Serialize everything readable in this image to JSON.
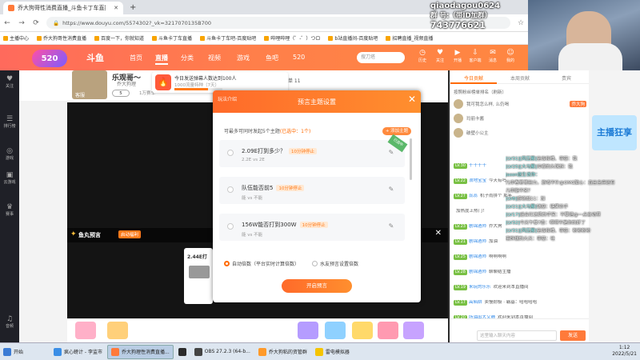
{
  "browser": {
    "tab_title": "乔大狗哥性消费直播_斗鱼卡丁车直播",
    "new_tab": "+",
    "url": "https://www.douyu.com/5574302?_vk=3217070135B700",
    "bookmarks": [
      "主播中心",
      "乔大狗哥性消费直播",
      "百度一下，你就知道",
      "斗鱼卡丁车直播",
      "斗鱼卡丁车吧-百度贴吧",
      "哔哩哔哩（゜-゜）つロ",
      "b站直播间-百度贴吧",
      "招聘直播_视频直播"
    ]
  },
  "header": {
    "badge": "520",
    "logo": "斗鱼",
    "nav": [
      "首页",
      "直播",
      "分类",
      "视频",
      "游戏",
      "鱼吧",
      "520"
    ],
    "active_nav": "直播",
    "search_placeholder": "搜刀塔",
    "icons": [
      {
        "icon": "bell-icon",
        "label": "历史"
      },
      {
        "icon": "heart-icon",
        "label": "关注"
      },
      {
        "icon": "live-icon",
        "label": "开播"
      },
      {
        "icon": "download-icon",
        "label": "客户端"
      },
      {
        "icon": "message-icon",
        "label": "消息"
      },
      {
        "icon": "user-icon",
        "label": "我的"
      }
    ]
  },
  "leftbar": [
    {
      "icon": "heart-icon",
      "label": "关注"
    },
    {
      "icon": "list-icon",
      "label": "排行榜"
    },
    {
      "icon": "gamepad-icon",
      "label": "游戏"
    },
    {
      "icon": "tv-icon",
      "label": "云游戏"
    },
    {
      "icon": "trophy-icon",
      "label": "赛事"
    },
    {
      "icon": "headset-icon",
      "label": "音频"
    }
  ],
  "stream": {
    "title": "乐观哥～",
    "owner": "乔大狗理",
    "stage": "客服",
    "follow_chip": "5",
    "sub_stat": "1万赛车",
    "fans_label": "粉丝榜单 11"
  },
  "notification": {
    "title": "今日发送弹幕人数达到100人",
    "subtitle": "1000流量特种（7天）",
    "progress": 0.7
  },
  "dialog": {
    "corner_label": "玩法介绍",
    "title": "预言主题设置",
    "hint": "可最多可同时发起5个主题",
    "hint_count": "(已选中：1个)",
    "add_button": "+ 添加主题",
    "topics": [
      {
        "question": "2.09E打到多少？",
        "status": "10分钟停止",
        "options": "2.2E vs 2E",
        "selected": true,
        "ribbon": "已选中"
      },
      {
        "question": "队伍能否前5",
        "status": "10分钟停止",
        "options": "能 vs 不能",
        "selected": false
      },
      {
        "question": "156W能否打到300W",
        "status": "10分钟停止",
        "options": "能 vs 不能",
        "selected": false
      }
    ],
    "mode_auto": "自动倍数（平台实时计算倍数）",
    "mode_fixed": "水友预言设置倍数",
    "start_button": "开启预言"
  },
  "prediction_bar": {
    "title": "鱼丸预言",
    "tag": "启动福利",
    "close": "✕",
    "card_value": "2.44E打"
  },
  "chat": {
    "tabs": [
      "今日贡献",
      "本周贡献",
      "贵宾"
    ],
    "active_tab": 0,
    "notice": "按照粉丝榜单排名（刷新）",
    "ranks": [
      {
        "name": "我可我怎么样, 么仍喝",
        "tag": "乔大狗"
      },
      {
        "name": "玛丽卡酱",
        "tag": ""
      },
      {
        "name": "破壁小公主",
        "tag": ""
      }
    ],
    "messages": [
      {
        "lv": "LV.30",
        "user": "十十十十",
        "text": ""
      },
      {
        "lv": "LV.22",
        "user": "浪地宝宝",
        "text": "今天有吗"
      },
      {
        "lv": "LV.27",
        "user": "蕊蕊",
        "text": "机子雨拼个 那年"
      },
      {
        "lv": "",
        "user": "",
        "text": "加热度上热门！"
      },
      {
        "lv": "LV.23",
        "user": "剧锦酒师",
        "text": "乔大狗"
      },
      {
        "lv": "LV.21",
        "user": "剧锦酒师",
        "text": "加油"
      },
      {
        "lv": "LV.25",
        "user": "剧锦酒师",
        "text": "啊啊啊啊"
      },
      {
        "lv": "LV.28",
        "user": "剧锦酒师",
        "text": "聊聊结主播"
      },
      {
        "lv": "LV.19",
        "user": "来玩的乐乐",
        "text": "欢迎来到本直播间"
      },
      {
        "lv": "LV.17",
        "user": "高陷阱",
        "text": "卖慢耐极 · 霸基：哈哈哈哈"
      },
      {
        "lv": "LV.20",
        "user": "所油出大又肺",
        "text": "欢迎来到本直播间"
      }
    ]
  },
  "overlay_chat": [
    {
      "lv": "[LV31]",
      "user": "[风压展]",
      "text": "圣级和桶、菲基：我"
    },
    {
      "lv": "[LV25]",
      "user": "[大马展]",
      "text": "浑睿的头球斜：我"
    },
    {
      "lv": "",
      "user": "Jason医生说你：",
      "text": ""
    },
    {
      "lv": "",
      "user": "",
      "text": "几率看哥哥努力，游戏不什@OMG脑心：直且全麻还有"
    },
    {
      "lv": "",
      "user": "",
      "text": "几率能不来？"
    },
    {
      "lv": "[LV8]",
      "user": "",
      "text": "感谢战11：加"
    },
    {
      "lv": "[LV21]",
      "user": "[大马展]",
      "text": "钱塞：糖果杀手"
    },
    {
      "lv": "[LV17]",
      "user": "",
      "text": "遥合红达奶的手笑：不要搭@一点自动啊"
    },
    {
      "lv": "[LV32]",
      "user": "",
      "text": "今天午餐7香：啊啊不是你的好了"
    },
    {
      "lv": "[LV31]",
      "user": "[风压展]",
      "text": "圣级和桶、菲基：粉粉粉粉"
    },
    {
      "lv": "",
      "user": "",
      "text": "俄饰拔的大天：菲基：哇"
    }
  ],
  "chat_input": {
    "placeholder": "这里输入聊天内容",
    "send": "发送"
  },
  "camera_overlay": {
    "line1": "qiaodagou0624",
    "line2": "群  号:（带ID加群）",
    "line3": "743776621"
  },
  "taskbar": {
    "start": "开始",
    "items": [
      "疯心螃计 - 李监市",
      "乔大狗理性消费直播...",
      "",
      "OBS 27.2.3 (64-b...",
      "乔大狗粘的资管群",
      "雷电模拟器"
    ],
    "active_index": 1,
    "time": "1:12",
    "date": "2022/5/21"
  },
  "colors": {
    "brand": "#ff7a3a",
    "accent": "#ff6a00",
    "level_green": "#78c043"
  }
}
